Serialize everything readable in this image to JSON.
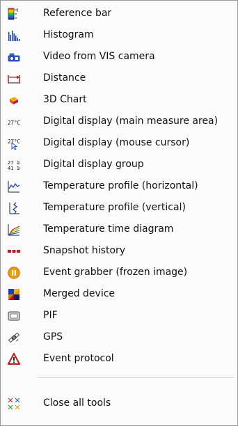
{
  "menu": {
    "items": [
      {
        "label": "Reference bar",
        "icon": "reference-bar-icon"
      },
      {
        "label": "Histogram",
        "icon": "histogram-icon"
      },
      {
        "label": "Video from VIS camera",
        "icon": "vis-camera-icon"
      },
      {
        "label": "Distance",
        "icon": "distance-icon"
      },
      {
        "label": "3D Chart",
        "icon": "3d-chart-icon"
      },
      {
        "label": "Digital display (main measure area)",
        "icon": "digital-display-main-icon"
      },
      {
        "label": "Digital display (mouse cursor)",
        "icon": "digital-display-cursor-icon"
      },
      {
        "label": "Digital display group",
        "icon": "digital-display-group-icon"
      },
      {
        "label": "Temperature profile (horizontal)",
        "icon": "temperature-profile-horizontal-icon"
      },
      {
        "label": "Temperature profile (vertical)",
        "icon": "temperature-profile-vertical-icon"
      },
      {
        "label": "Temperature time diagram",
        "icon": "temperature-time-diagram-icon"
      },
      {
        "label": "Snapshot history",
        "icon": "snapshot-history-icon"
      },
      {
        "label": "Event grabber (frozen image)",
        "icon": "event-grabber-icon"
      },
      {
        "label": "Merged device",
        "icon": "merged-device-icon"
      },
      {
        "label": "PIF",
        "icon": "pif-icon"
      },
      {
        "label": "GPS",
        "icon": "gps-icon"
      },
      {
        "label": "Event protocol",
        "icon": "event-protocol-icon"
      }
    ],
    "close_all": {
      "label": "Close all tools",
      "icon": "close-all-icon"
    },
    "icon_text": {
      "digital_main": "27°C",
      "digital_cursor": "27°C",
      "digital_group_top": "27 18",
      "digital_group_bottom": "41 10"
    }
  }
}
